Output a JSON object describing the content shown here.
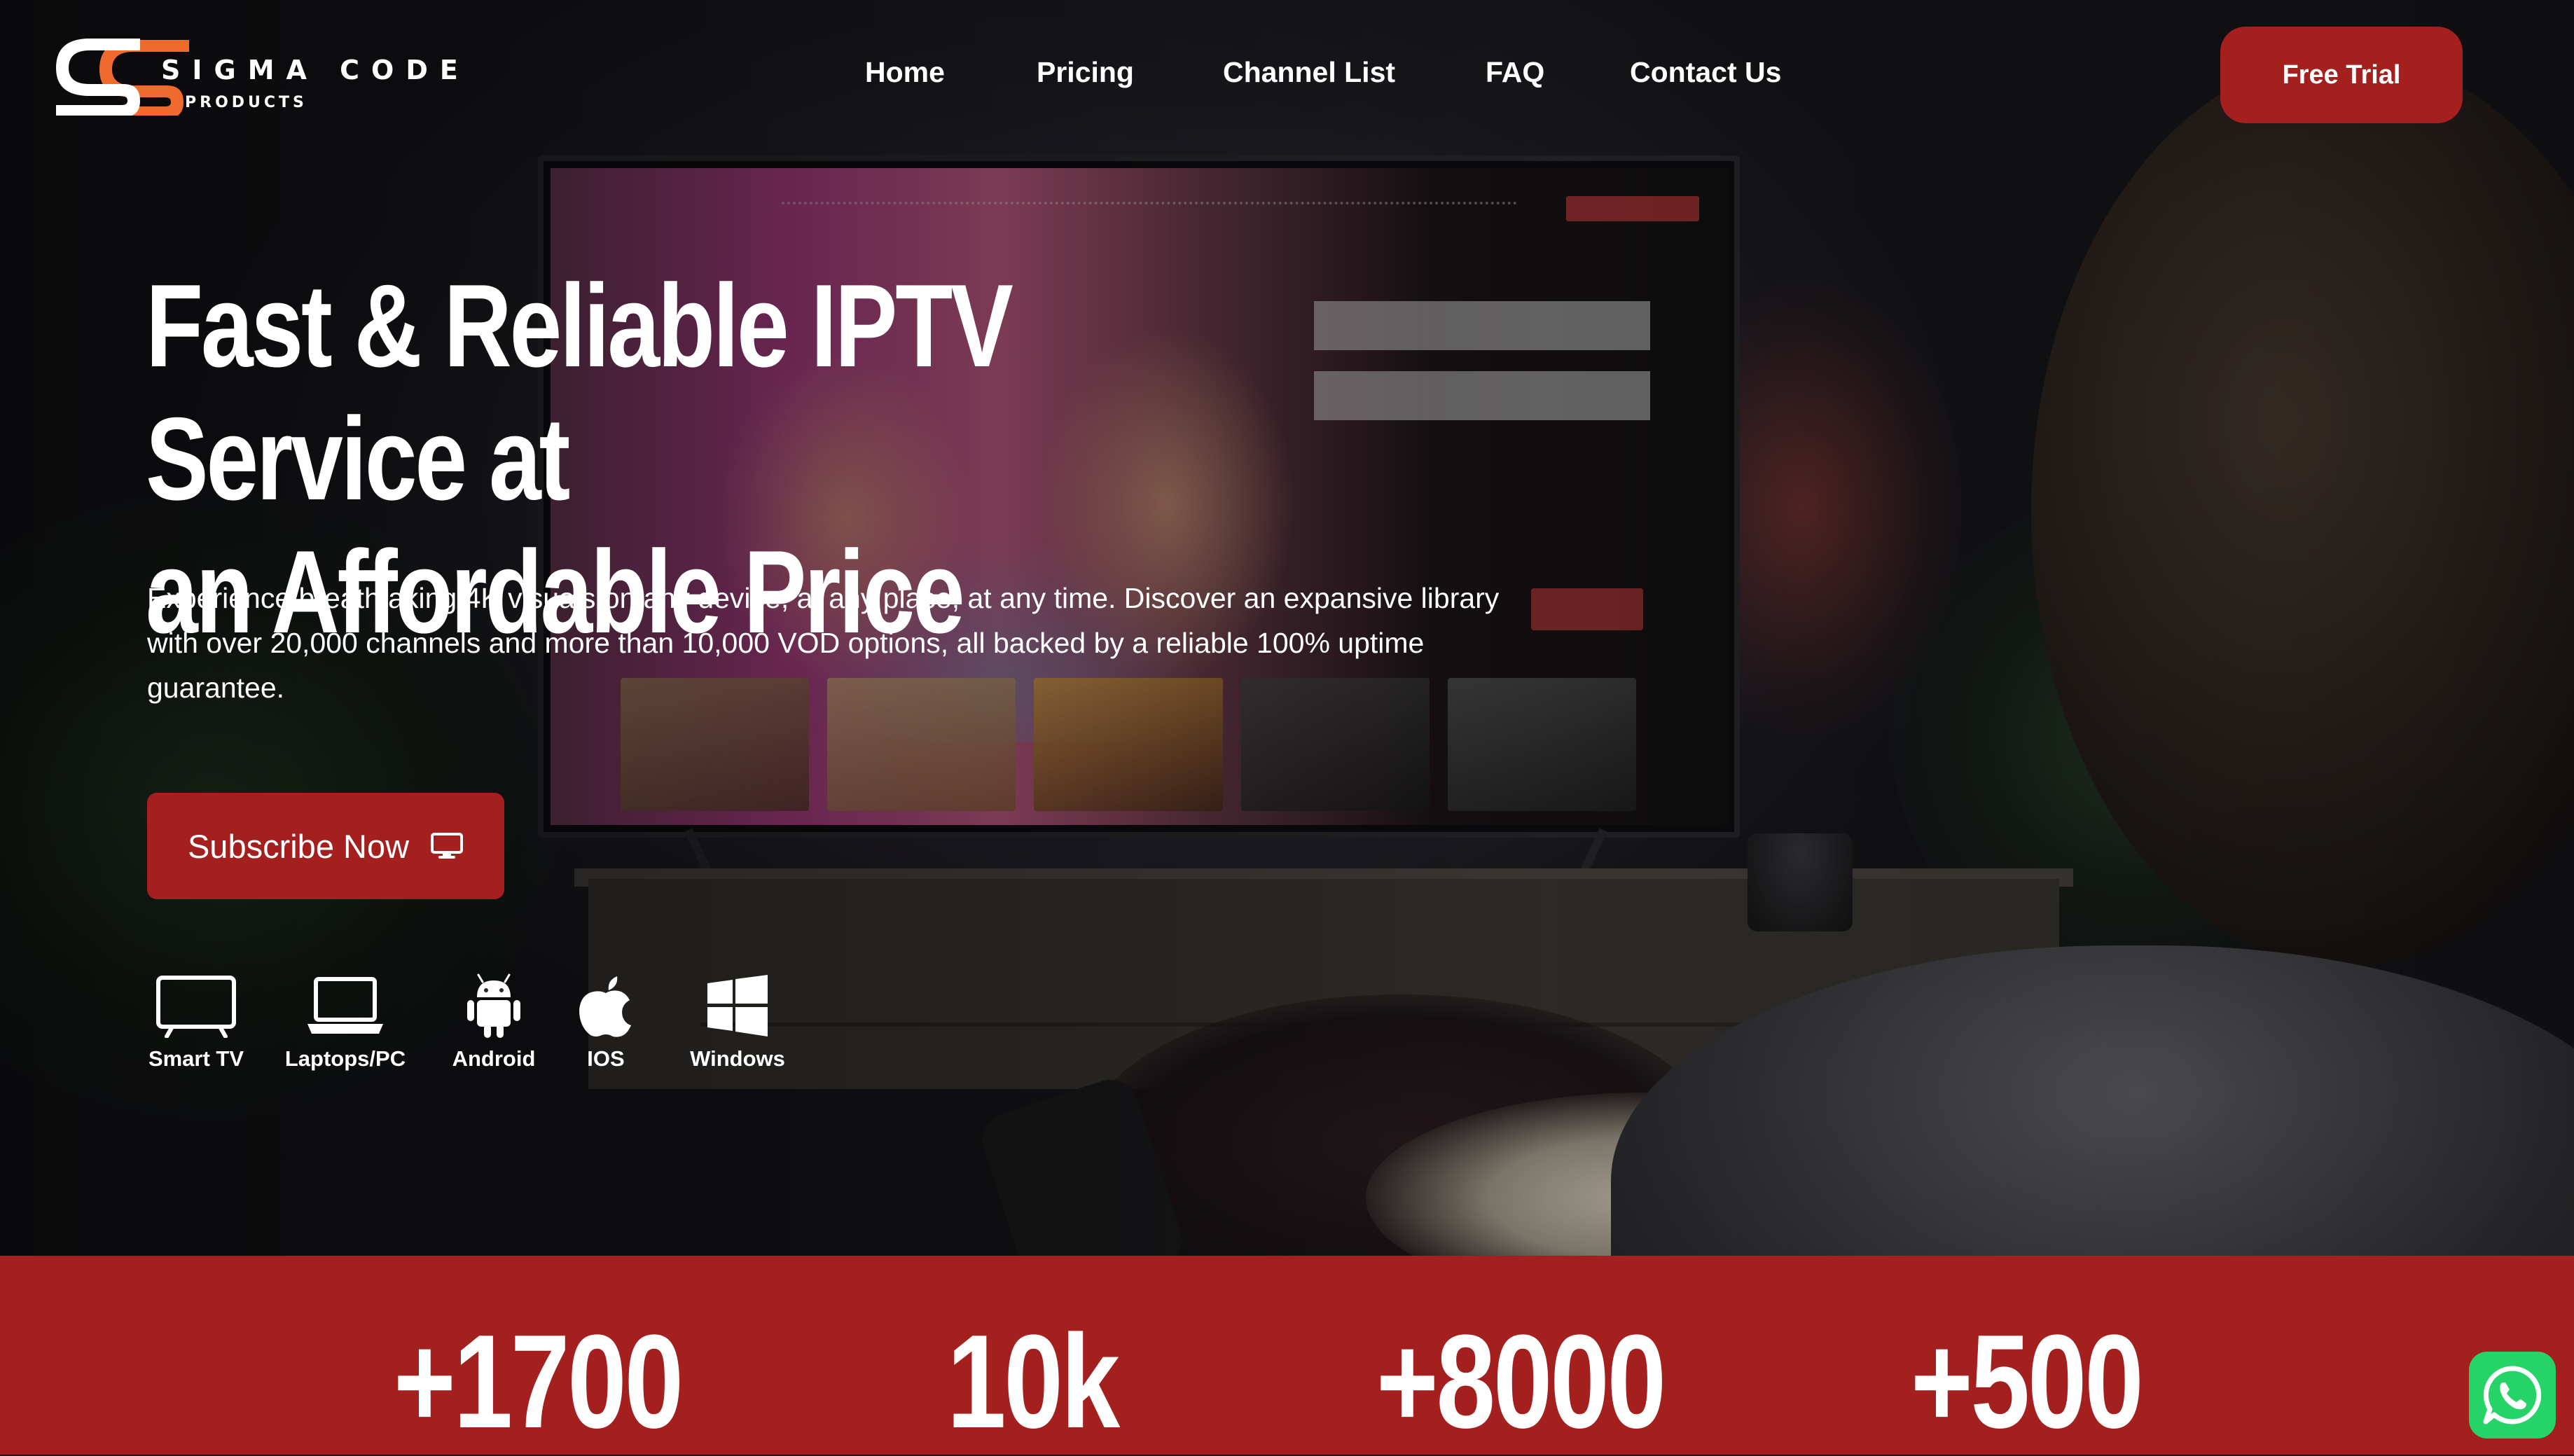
{
  "brand": {
    "name": "SIGMA CODE",
    "sub": "PRODUCTS",
    "accent": "#a4201f",
    "logo_orange": "#ef6a2c"
  },
  "nav": {
    "items": [
      "Home",
      "Pricing",
      "Channel List",
      "FAQ",
      "Contact Us"
    ],
    "cta": "Free Trial"
  },
  "hero": {
    "title_line1": "Fast & Reliable IPTV Service at",
    "title_line2": "an Affordable Price",
    "description": "Experience breathtaking 4K visuals on any device, at any place, at any time. Discover an expansive library with over 20,000 channels and more than 10,000 VOD options, all backed by a reliable 100% uptime guarantee.",
    "cta": "Subscribe Now",
    "cta_icon": "monitor-icon"
  },
  "devices": [
    {
      "label": "Smart TV",
      "icon": "smart-tv-icon"
    },
    {
      "label": "Laptops/PC",
      "icon": "laptop-icon"
    },
    {
      "label": "Android",
      "icon": "android-icon"
    },
    {
      "label": "IOS",
      "icon": "apple-icon"
    },
    {
      "label": "Windows",
      "icon": "windows-icon"
    }
  ],
  "stats": [
    "+1700",
    "10k",
    "+8000",
    "+500"
  ],
  "floating": {
    "icon": "whatsapp-icon",
    "color": "#25d366"
  }
}
